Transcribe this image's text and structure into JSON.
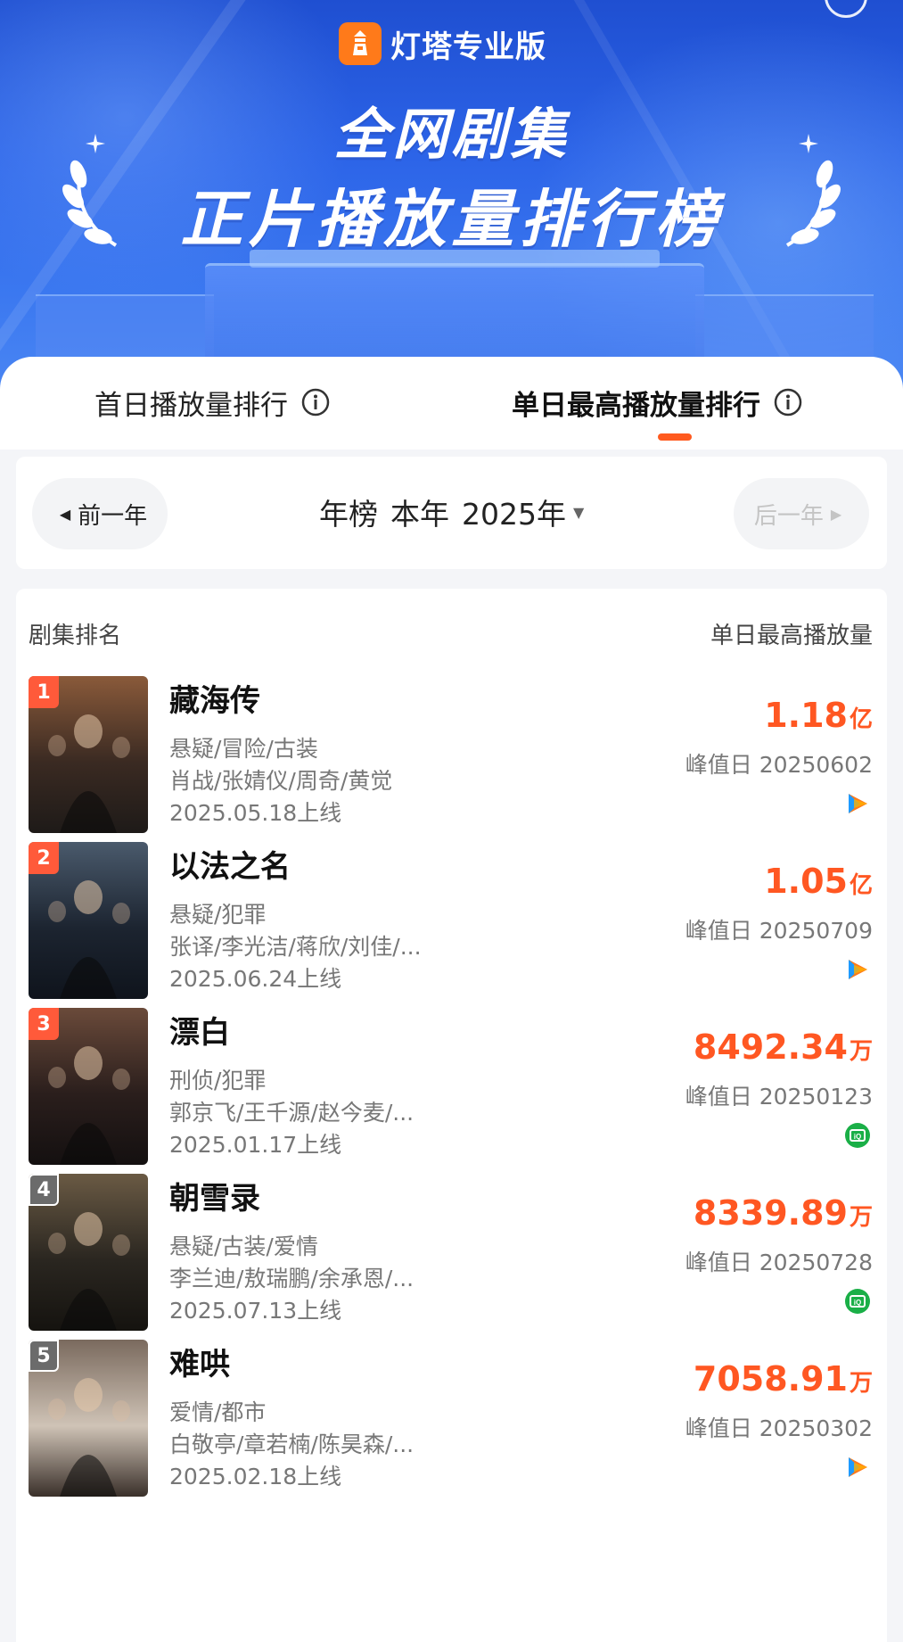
{
  "brand": {
    "name": "灯塔专业版",
    "icon": "lighthouse-icon",
    "color": "#ff7a1a"
  },
  "banner": {
    "title_line1": "全网剧集",
    "title_line2": "正片播放量排行榜"
  },
  "tabs": [
    {
      "label": "首日播放量排行",
      "active": false
    },
    {
      "label": "单日最高播放量排行",
      "active": true
    }
  ],
  "year_selector": {
    "prev_label": "前一年",
    "next_label": "后一年",
    "mode": "年榜",
    "period": "本年",
    "year": "2025年"
  },
  "list": {
    "col_left": "剧集排名",
    "col_right": "单日最高播放量",
    "peak_prefix": "峰值日",
    "items": [
      {
        "rank": "1",
        "title": "藏海传",
        "genre": "悬疑/冒险/古装",
        "cast": "肖战/张婧仪/周奇/黄觉",
        "release": "2025.05.18上线",
        "value": "1.18",
        "unit": "亿",
        "peak_date": "20250602",
        "platform": "youku-icon"
      },
      {
        "rank": "2",
        "title": "以法之名",
        "genre": "悬疑/犯罪",
        "cast": "张译/李光洁/蒋欣/刘佳/...",
        "release": "2025.06.24上线",
        "value": "1.05",
        "unit": "亿",
        "peak_date": "20250709",
        "platform": "youku-icon"
      },
      {
        "rank": "3",
        "title": "漂白",
        "genre": "刑侦/犯罪",
        "cast": "郭京飞/王千源/赵今麦/...",
        "release": "2025.01.17上线",
        "value": "8492.34",
        "unit": "万",
        "peak_date": "20250123",
        "platform": "iqiyi-icon"
      },
      {
        "rank": "4",
        "title": "朝雪录",
        "genre": "悬疑/古装/爱情",
        "cast": "李兰迪/敖瑞鹏/余承恩/...",
        "release": "2025.07.13上线",
        "value": "8339.89",
        "unit": "万",
        "peak_date": "20250728",
        "platform": "iqiyi-icon"
      },
      {
        "rank": "5",
        "title": "难哄",
        "genre": "爱情/都市",
        "cast": "白敬亭/章若楠/陈昊森/...",
        "release": "2025.02.18上线",
        "value": "7058.91",
        "unit": "万",
        "peak_date": "20250302",
        "platform": "youku-icon"
      }
    ]
  },
  "colors": {
    "accent": "#ff5722",
    "banner": "#2c64e8"
  }
}
